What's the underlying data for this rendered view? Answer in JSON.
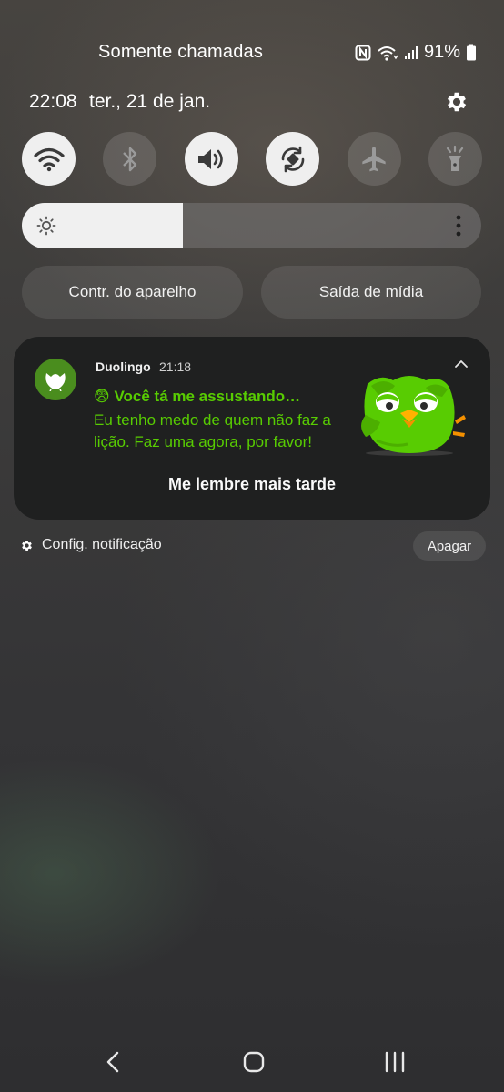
{
  "status_bar": {
    "carrier_text": "Somente chamadas",
    "battery_percent": "91%",
    "icons": [
      "nfc-icon",
      "wifi-call-icon",
      "signal-icon",
      "battery-icon"
    ]
  },
  "header": {
    "time": "22:08",
    "date": "ter., 21 de jan.",
    "settings_icon": "gear-icon"
  },
  "quick_toggles": [
    {
      "name": "wifi",
      "icon": "wifi-icon",
      "active": true
    },
    {
      "name": "bluetooth",
      "icon": "bluetooth-icon",
      "active": false
    },
    {
      "name": "sound",
      "icon": "speaker-icon",
      "active": true
    },
    {
      "name": "auto-rotate",
      "icon": "rotate-icon",
      "active": true
    },
    {
      "name": "airplane-mode",
      "icon": "airplane-icon",
      "active": false
    },
    {
      "name": "flashlight",
      "icon": "flashlight-icon",
      "active": false
    }
  ],
  "brightness": {
    "level": 0.35
  },
  "panels": {
    "device_control": "Contr. do aparelho",
    "media_output": "Saída de mídia"
  },
  "notification": {
    "app_name": "Duolingo",
    "time": "21:18",
    "title": "😨 Você tá me assustando…",
    "body": "Eu tenho medo de quem não faz a lição. Faz uma agora, por favor!",
    "action_label": "Me lembre mais tarde",
    "accent_color": "#58cc02"
  },
  "footer": {
    "config_label": "Config. notificação",
    "clear_label": "Apagar"
  },
  "nav": [
    "back-icon",
    "home-icon",
    "recents-icon"
  ]
}
